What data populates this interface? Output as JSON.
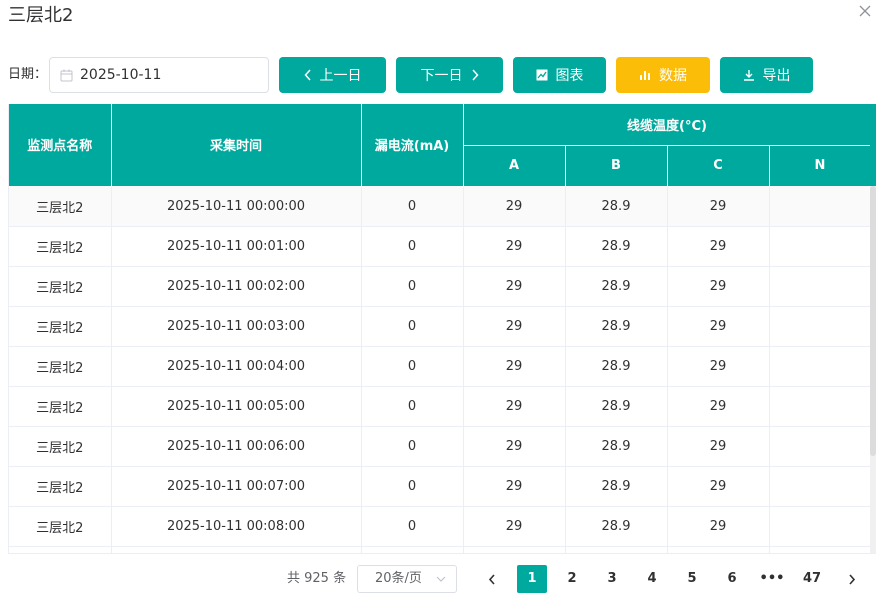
{
  "dialog": {
    "title": "三层北2"
  },
  "toolbar": {
    "date_label": "日期：",
    "date_value": "2025-10-11",
    "prev_day": "上一日",
    "next_day": "下一日",
    "chart": "图表",
    "data": "数据",
    "export": "导出"
  },
  "colors": {
    "accent": "#00a99d",
    "active_view": "#fbbd08"
  },
  "table": {
    "headers": {
      "name": "监测点名称",
      "time": "采集时间",
      "leak": "漏电流(mA)",
      "temp_group": "线缆温度(°C)",
      "a": "A",
      "b": "B",
      "c": "C",
      "n": "N"
    },
    "rows": [
      {
        "name": "三层北2",
        "time": "2025-10-11 00:00:00",
        "leak": "0",
        "a": "29",
        "b": "28.9",
        "c": "29",
        "n": ""
      },
      {
        "name": "三层北2",
        "time": "2025-10-11 00:01:00",
        "leak": "0",
        "a": "29",
        "b": "28.9",
        "c": "29",
        "n": ""
      },
      {
        "name": "三层北2",
        "time": "2025-10-11 00:02:00",
        "leak": "0",
        "a": "29",
        "b": "28.9",
        "c": "29",
        "n": ""
      },
      {
        "name": "三层北2",
        "time": "2025-10-11 00:03:00",
        "leak": "0",
        "a": "29",
        "b": "28.9",
        "c": "29",
        "n": ""
      },
      {
        "name": "三层北2",
        "time": "2025-10-11 00:04:00",
        "leak": "0",
        "a": "29",
        "b": "28.9",
        "c": "29",
        "n": ""
      },
      {
        "name": "三层北2",
        "time": "2025-10-11 00:05:00",
        "leak": "0",
        "a": "29",
        "b": "28.9",
        "c": "29",
        "n": ""
      },
      {
        "name": "三层北2",
        "time": "2025-10-11 00:06:00",
        "leak": "0",
        "a": "29",
        "b": "28.9",
        "c": "29",
        "n": ""
      },
      {
        "name": "三层北2",
        "time": "2025-10-11 00:07:00",
        "leak": "0",
        "a": "29",
        "b": "28.9",
        "c": "29",
        "n": ""
      },
      {
        "name": "三层北2",
        "time": "2025-10-11 00:08:00",
        "leak": "0",
        "a": "29",
        "b": "28.9",
        "c": "29",
        "n": ""
      },
      {
        "name": "",
        "time": "",
        "leak": "",
        "a": "",
        "b": "",
        "c": "",
        "n": ""
      }
    ]
  },
  "pagination": {
    "total": "共 925 条",
    "page_size": "20条/页",
    "pages": [
      "1",
      "2",
      "3",
      "4",
      "5",
      "6",
      "•••",
      "47"
    ],
    "current": "1"
  }
}
